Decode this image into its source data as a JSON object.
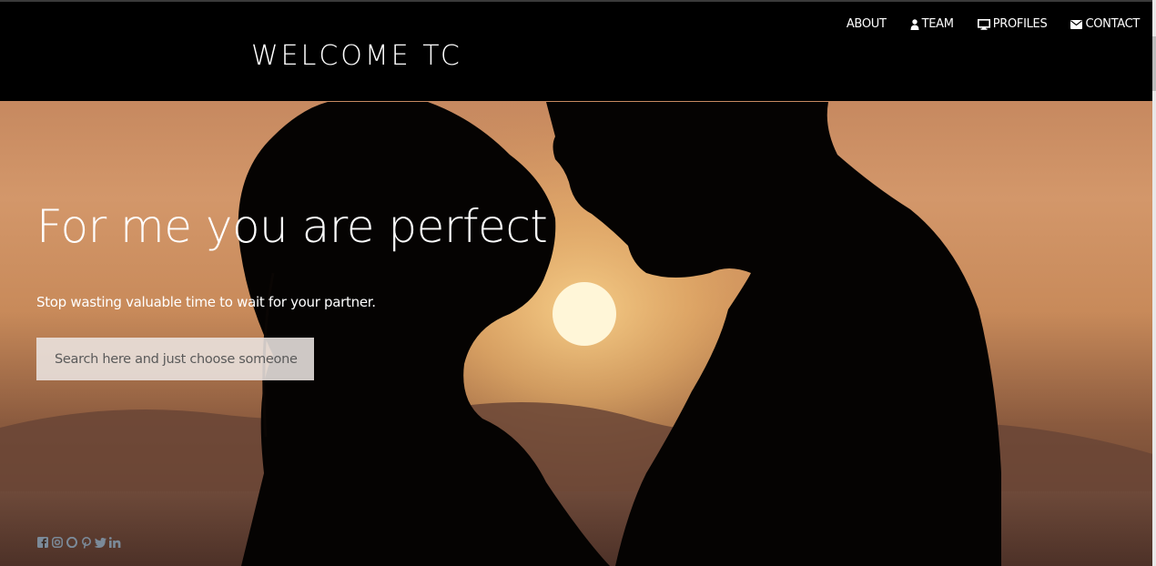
{
  "header": {
    "welcome_text": "WELCOME TC"
  },
  "nav": {
    "items": [
      {
        "label": "ABOUT",
        "icon": "none"
      },
      {
        "label": "TEAM",
        "icon": "user-icon"
      },
      {
        "label": "PROFILES",
        "icon": "monitor-icon"
      },
      {
        "label": "CONTACT",
        "icon": "envelope-icon"
      }
    ]
  },
  "hero": {
    "headline": "For me you are perfect",
    "subline": "Stop wasting valuable time to wait for your partner.",
    "search_placeholder": "Search here and just choose someone"
  },
  "social": {
    "icons": [
      "facebook-icon",
      "instagram-icon",
      "opera-icon",
      "pinterest-icon",
      "twitter-icon",
      "linkedin-icon"
    ]
  },
  "colors": {
    "topbar": "#000000",
    "sky_top": "#c9895a",
    "sky_mid": "#e0a868",
    "sun": "#fff4d0",
    "social_icon": "#7b8a99"
  }
}
